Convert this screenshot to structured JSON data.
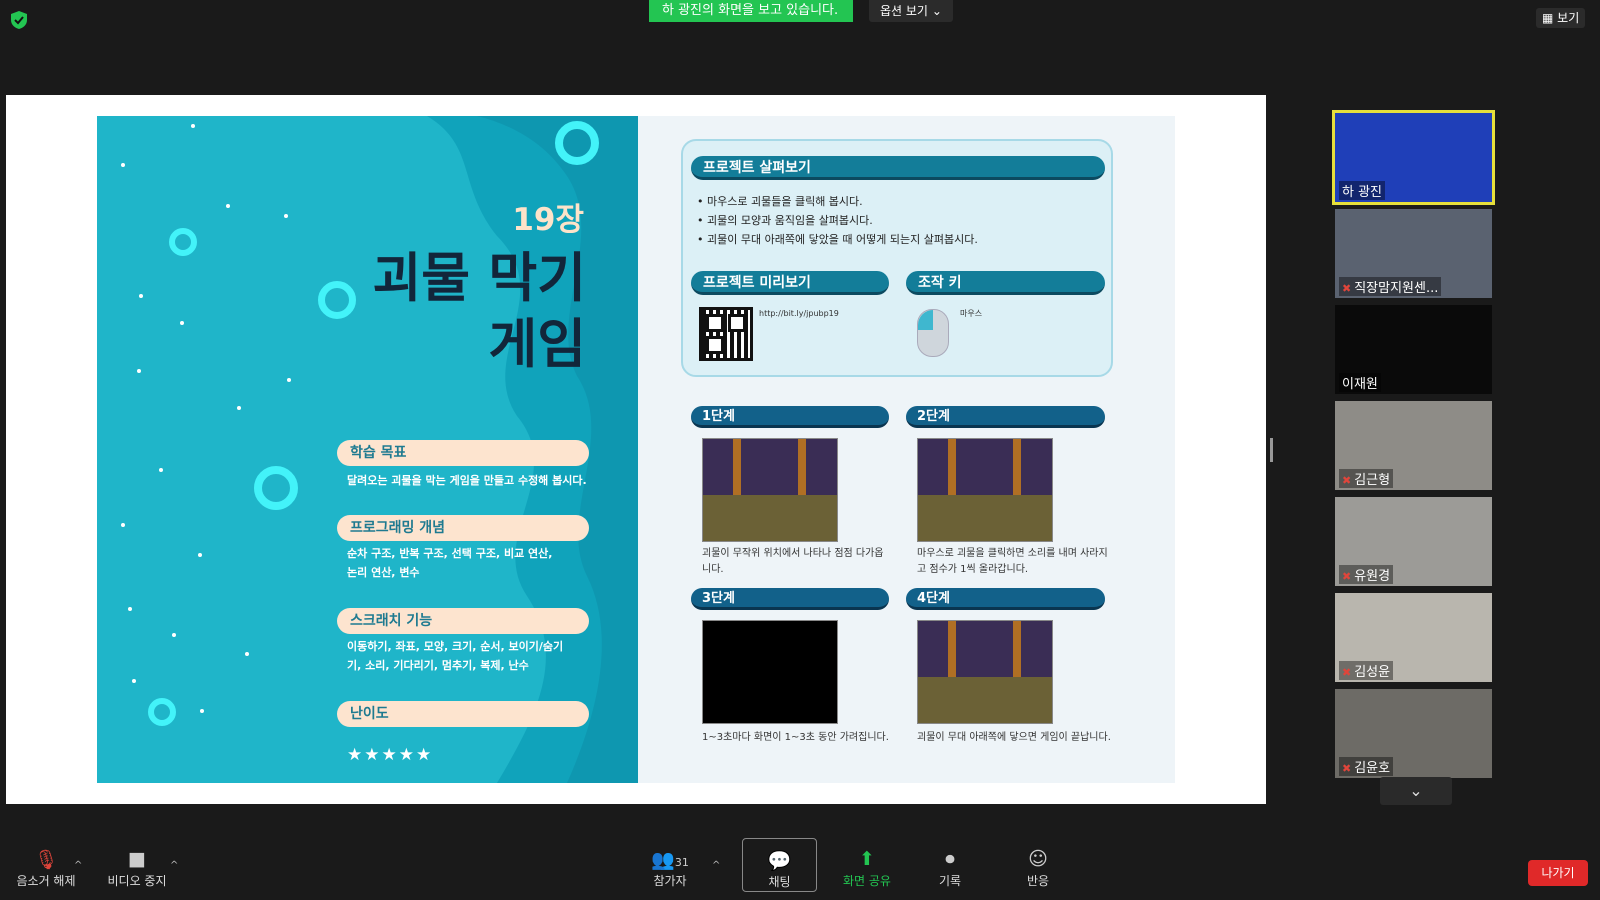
{
  "header": {
    "viewing_banner": "하 광진의 화면을 보고 있습니다.",
    "view_options": "옵션 보기",
    "view_button": "보기"
  },
  "slide": {
    "chapter": "19장",
    "title_line1": "괴물 막기",
    "title_line2": "게임",
    "sections": [
      {
        "label": "학습 목표",
        "text": "달려오는 괴물을 막는 게임을 만들고 수정해 봅시다."
      },
      {
        "label": "프로그래밍 개념",
        "text": "순차 구조, 반복 구조, 선택 구조, 비교 연산, 논리 연산, 변수"
      },
      {
        "label": "스크래치 기능",
        "text": "이동하기, 좌표, 모양, 크기, 순서, 보이기/숨기기, 소리, 기다리기, 멈추기, 복제, 난수"
      },
      {
        "label": "난이도",
        "text": ""
      }
    ],
    "difficulty_stars": "★★★★★",
    "overview": {
      "label": "프로젝트 살펴보기",
      "bullets": [
        "마우스로 괴물들을 클릭해 봅시다.",
        "괴물의 모양과 움직임을 살펴봅시다.",
        "괴물이 무대 아래쪽에 닿았을 때 어떻게 되는지 살펴봅시다."
      ]
    },
    "preview": {
      "label": "프로젝트 미리보기",
      "url": "http://bit.ly/jpubp19"
    },
    "controls": {
      "label": "조작 키",
      "key": "마우스"
    },
    "steps": [
      {
        "label": "1단계",
        "desc": "괴물이 무작위 위치에서 나타나 점점 다가옵니다."
      },
      {
        "label": "2단계",
        "desc": "마우스로 괴물을 클릭하면 소리를 내며 사라지고 점수가 1씩 올라갑니다."
      },
      {
        "label": "3단계",
        "desc": "1~3초마다 화면이 1~3초 동안 가려집니다."
      },
      {
        "label": "4단계",
        "desc": "괴물이 무대 아래쪽에 닿으면 게임이 끝납니다."
      }
    ]
  },
  "participants": [
    {
      "name": "하 광진",
      "muted": false,
      "active": true
    },
    {
      "name": "직장맘지원센...",
      "muted": true
    },
    {
      "name": "이재원",
      "muted": false
    },
    {
      "name": "김근형",
      "muted": true
    },
    {
      "name": "유원경",
      "muted": true
    },
    {
      "name": "김성윤",
      "muted": true
    },
    {
      "name": "김윤호",
      "muted": true
    }
  ],
  "toolbar": {
    "unmute": "음소거 해제",
    "stop_video": "비디오 중지",
    "participants": "참가자",
    "participants_count": "31",
    "chat": "채팅",
    "share_screen": "화면 공유",
    "record": "기록",
    "reactions": "반응",
    "leave": "나가기"
  },
  "colors": {
    "accent_green": "#23c552",
    "leave_red": "#e02929",
    "slide_teal": "#1fb5c9"
  }
}
